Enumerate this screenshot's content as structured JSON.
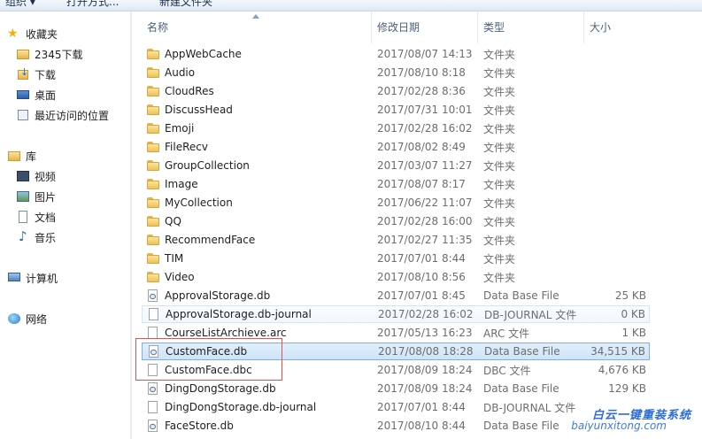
{
  "toolbar": {
    "organize": "组织 ▾",
    "open_with": "打开方式...",
    "new_folder": "新建文件夹"
  },
  "nav": {
    "favorites": "收藏夹",
    "fav_items": [
      "2345下载",
      "下载",
      "桌面",
      "最近访问的位置"
    ],
    "libraries": "库",
    "lib_items": [
      "视频",
      "图片",
      "文档",
      "音乐"
    ],
    "computer": "计算机",
    "network": "网络"
  },
  "columns": {
    "name": "名称",
    "date": "修改日期",
    "type": "类型",
    "size": "大小"
  },
  "files": [
    {
      "name": "AppWebCache",
      "date": "2017/08/07 14:13",
      "type": "文件夹",
      "size": "",
      "icon": "folder-icon"
    },
    {
      "name": "Audio",
      "date": "2017/08/10 8:18",
      "type": "文件夹",
      "size": "",
      "icon": "folder-icon"
    },
    {
      "name": "CloudRes",
      "date": "2017/02/28 8:36",
      "type": "文件夹",
      "size": "",
      "icon": "folder-icon"
    },
    {
      "name": "DiscussHead",
      "date": "2017/07/31 10:01",
      "type": "文件夹",
      "size": "",
      "icon": "folder-icon"
    },
    {
      "name": "Emoji",
      "date": "2017/02/28 16:02",
      "type": "文件夹",
      "size": "",
      "icon": "folder-icon"
    },
    {
      "name": "FileRecv",
      "date": "2017/08/02 8:49",
      "type": "文件夹",
      "size": "",
      "icon": "folder-icon"
    },
    {
      "name": "GroupCollection",
      "date": "2017/03/07 11:27",
      "type": "文件夹",
      "size": "",
      "icon": "folder-icon"
    },
    {
      "name": "Image",
      "date": "2017/08/07 8:17",
      "type": "文件夹",
      "size": "",
      "icon": "folder-icon"
    },
    {
      "name": "MyCollection",
      "date": "2017/06/22 11:07",
      "type": "文件夹",
      "size": "",
      "icon": "folder-icon"
    },
    {
      "name": "QQ",
      "date": "2017/02/28 16:00",
      "type": "文件夹",
      "size": "",
      "icon": "folder-icon"
    },
    {
      "name": "RecommendFace",
      "date": "2017/02/27 11:35",
      "type": "文件夹",
      "size": "",
      "icon": "folder-icon"
    },
    {
      "name": "TIM",
      "date": "2017/07/01 8:44",
      "type": "文件夹",
      "size": "",
      "icon": "folder-icon"
    },
    {
      "name": "Video",
      "date": "2017/08/10 8:56",
      "type": "文件夹",
      "size": "",
      "icon": "folder-icon"
    },
    {
      "name": "ApprovalStorage.db",
      "date": "2017/07/01 8:45",
      "type": "Data Base File",
      "size": "25 KB",
      "icon": "database-file-icon"
    },
    {
      "name": "ApprovalStorage.db-journal",
      "date": "2017/02/28 16:02",
      "type": "DB-JOURNAL 文件",
      "size": "0 KB",
      "icon": "file-icon"
    },
    {
      "name": "CourseListArchieve.arc",
      "date": "2017/05/13 16:23",
      "type": "ARC 文件",
      "size": "1 KB",
      "icon": "file-icon"
    },
    {
      "name": "CustomFace.db",
      "date": "2017/08/08 18:28",
      "type": "Data Base File",
      "size": "34,515 KB",
      "icon": "database-file-icon"
    },
    {
      "name": "CustomFace.dbc",
      "date": "2017/08/09 18:24",
      "type": "DBC 文件",
      "size": "4,676 KB",
      "icon": "file-icon"
    },
    {
      "name": "DingDongStorage.db",
      "date": "2017/08/09 18:24",
      "type": "Data Base File",
      "size": "129 KB",
      "icon": "database-file-icon"
    },
    {
      "name": "DingDongStorage.db-journal",
      "date": "2017/07/01 8:44",
      "type": "DB-JOURNAL 文件",
      "size": "",
      "icon": "file-icon"
    },
    {
      "name": "FaceStore.db",
      "date": "2017/08/10 8:44",
      "type": "Data Base File",
      "size": "",
      "icon": "database-file-icon"
    }
  ],
  "hover_row": 14,
  "selected_row": 16,
  "watermark": {
    "title": "白云一键重装系统",
    "url": "baiyunxitong.com"
  }
}
